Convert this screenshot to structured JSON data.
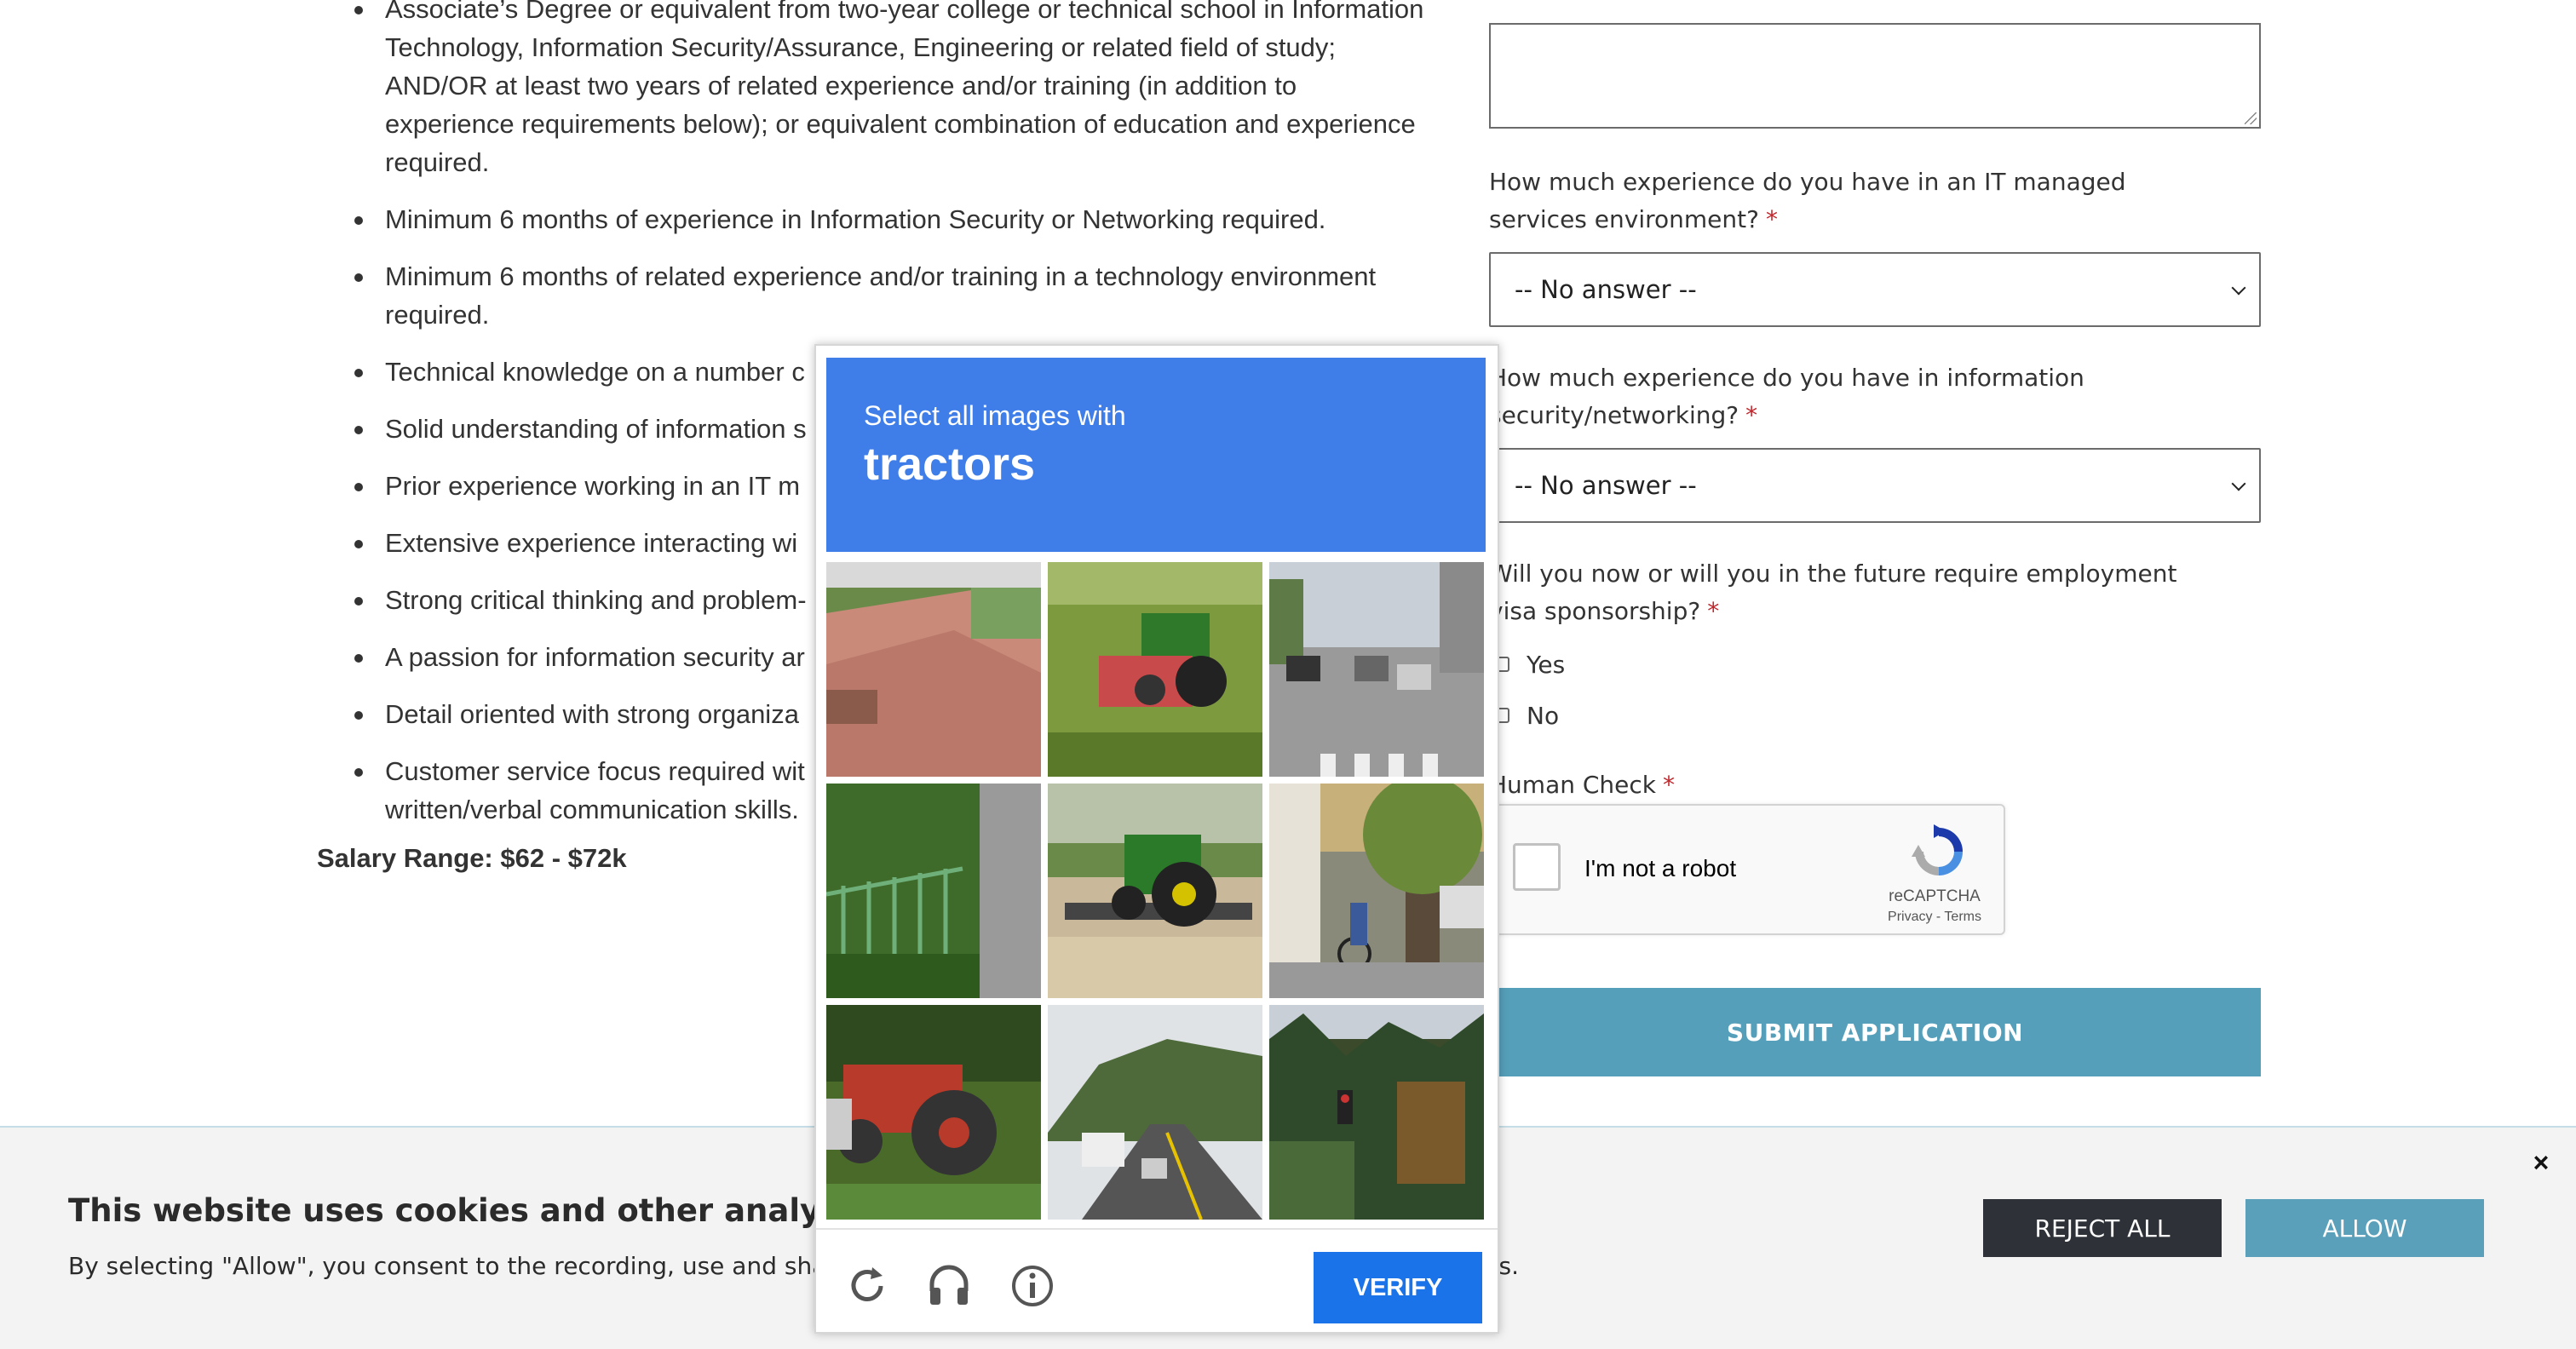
{
  "job": {
    "requirements": [
      "Associate’s Degree or equivalent from two-year college or technical school in Information Technology, Information Security/Assurance, Engineering or related field of study; AND/OR at least two years of related experience and/or training (in addition to experience requirements below); or equivalent combination of education and experience required.",
      "Minimum 6 months of experience in Information Security or Networking required.",
      "Minimum 6 months of related experience and/or training in a technology environment required.",
      "Technical knowledge on a number c",
      "Solid understanding of information s",
      "Prior experience working in an IT m",
      "Extensive experience interacting wi",
      "Strong critical thinking and problem-",
      "A passion for information security ar",
      "Detail oriented with strong organiza",
      "Customer service focus required wit written/verbal communication skills."
    ],
    "salary": "Salary Range: $62 - $72k"
  },
  "form": {
    "q_managed_services": "How much experience do you have in an IT managed services environment?",
    "q_infosec": "How much experience do you have in information security/networking?",
    "q_visa": "Will you now or will you in the future require employment visa sponsorship?",
    "required_mark": "*",
    "select_default": "-- No answer --",
    "visa_yes": "Yes",
    "visa_no": "No",
    "human_check": "Human Check",
    "recaptcha_label": "I'm not a robot",
    "recaptcha_brand": "reCAPTCHA",
    "recaptcha_terms": "Privacy - Terms",
    "submit": "SUBMIT APPLICATION"
  },
  "cookie": {
    "title": "This website uses cookies and other analytics techn",
    "text": "By selecting \"Allow\", you consent to the recording, use and sharing",
    "text_tail": "rs.",
    "reject": "REJECT ALL",
    "allow": "ALLOW",
    "close": "×"
  },
  "challenge": {
    "prompt": "Select all images with",
    "object": "tractors",
    "verify": "VERIFY",
    "tiles": [
      "brick-path",
      "tractor-field",
      "street-cars",
      "fence-grass",
      "tractor-trailer",
      "street-cyclist",
      "red-tractor",
      "road-bus",
      "trees-trafficlight"
    ]
  },
  "colors": {
    "challenge_header": "#3f7ee8",
    "verify_button": "#1a73e8",
    "submit_button": "#569fba",
    "reject_button": "#2e3238",
    "allow_button": "#5aa0ba",
    "required": "#c0272d"
  }
}
